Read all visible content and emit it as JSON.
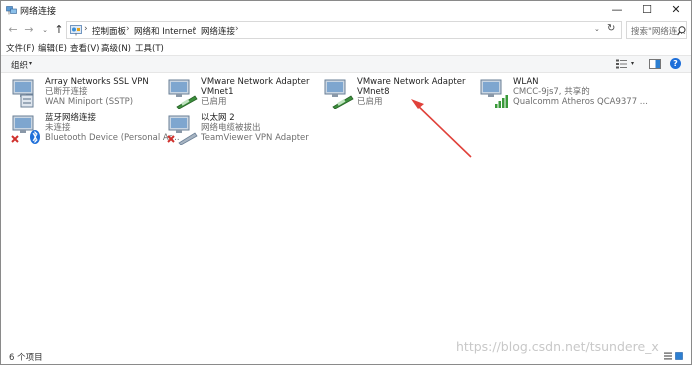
{
  "window": {
    "title": "网络连接",
    "minimize_glyph": "—",
    "maximize_glyph": "☐",
    "close_glyph": "✕"
  },
  "navigation": {
    "back_glyph": "←",
    "forward_glyph": "→",
    "history_glyph": "⌄",
    "up_glyph": "↑"
  },
  "address": {
    "breadcrumbs": [
      "控制面板",
      "网络和 Internet",
      "网络连接"
    ],
    "separator": "›",
    "dropdown_glyph": "⌄",
    "refresh_glyph": "↻"
  },
  "search": {
    "placeholder": "搜索\"网络连...",
    "icon": "search-icon"
  },
  "menu": {
    "items": [
      "文件(F)",
      "编辑(E)",
      "查看(V)",
      "高级(N)",
      "工具(T)"
    ]
  },
  "toolbar": {
    "organize_label": "组织",
    "caret": "▾",
    "help_label": "?"
  },
  "connections": [
    {
      "name": "Array Networks SSL VPN",
      "status": "已断开连接",
      "device": "WAN Miniport (SSTP)",
      "icon": "vpn-adapter-icon"
    },
    {
      "name": "VMware Network Adapter",
      "status": "VMnet1",
      "device": "已启用",
      "icon": "ethernet-adapter-icon"
    },
    {
      "name": "VMware Network Adapter",
      "status": "VMnet8",
      "device": "已启用",
      "icon": "ethernet-adapter-icon"
    },
    {
      "name": "WLAN",
      "status": "CMCC-9js7, 共享的",
      "device": "Qualcomm Atheros QCA9377 ...",
      "icon": "wifi-adapter-icon"
    },
    {
      "name": "蓝牙网络连接",
      "status": "未连接",
      "device": "Bluetooth Device (Personal Ar...",
      "icon": "bluetooth-adapter-icon"
    },
    {
      "name": "以太网 2",
      "status": "网络电缆被拔出",
      "device": "TeamViewer VPN Adapter",
      "icon": "ethernet-adapter-disconnected-icon"
    }
  ],
  "statusbar": {
    "item_count": "6 个项目"
  },
  "watermark": "https://blog.csdn.net/tsundere_x",
  "colors": {
    "accent": "#1e6fd9",
    "annotation_arrow": "#e0413a",
    "disconnected_x": "#d0312d",
    "signal_green": "#3a9a3a"
  }
}
